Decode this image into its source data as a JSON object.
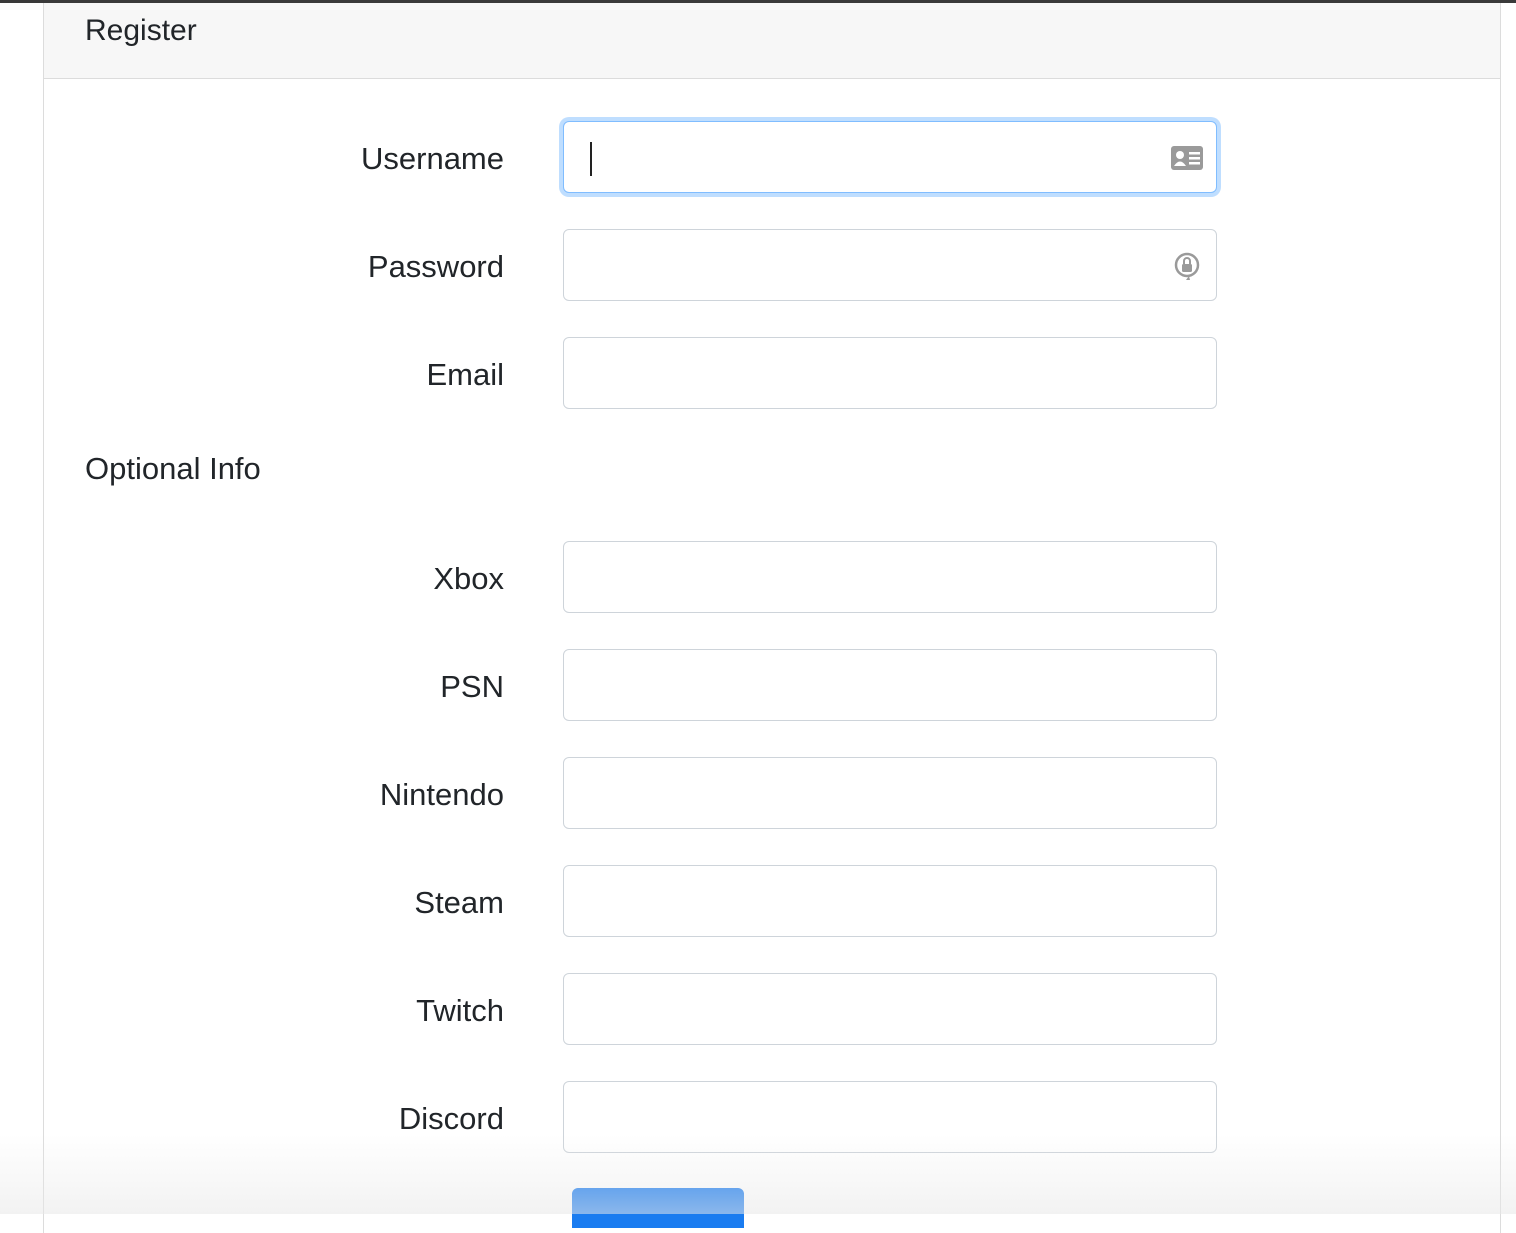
{
  "card": {
    "title": "Register"
  },
  "form": {
    "required_fields": [
      {
        "label": "Username",
        "value": ""
      },
      {
        "label": "Password",
        "value": ""
      },
      {
        "label": "Email",
        "value": ""
      }
    ],
    "optional_section_title": "Optional Info",
    "optional_fields": [
      {
        "label": "Xbox",
        "value": ""
      },
      {
        "label": "PSN",
        "value": ""
      },
      {
        "label": "Nintendo",
        "value": ""
      },
      {
        "label": "Steam",
        "value": ""
      },
      {
        "label": "Twitch",
        "value": ""
      },
      {
        "label": "Discord",
        "value": ""
      }
    ],
    "focused_field": "Username"
  },
  "icons": {
    "username_autofill": "contact-card-icon",
    "password_autofill": "password-key-icon"
  },
  "colors": {
    "accent": "#1a7cf0",
    "focus_ring": "#80bdff",
    "field_border": "#ced4da",
    "header_bg": "#f7f7f7"
  }
}
